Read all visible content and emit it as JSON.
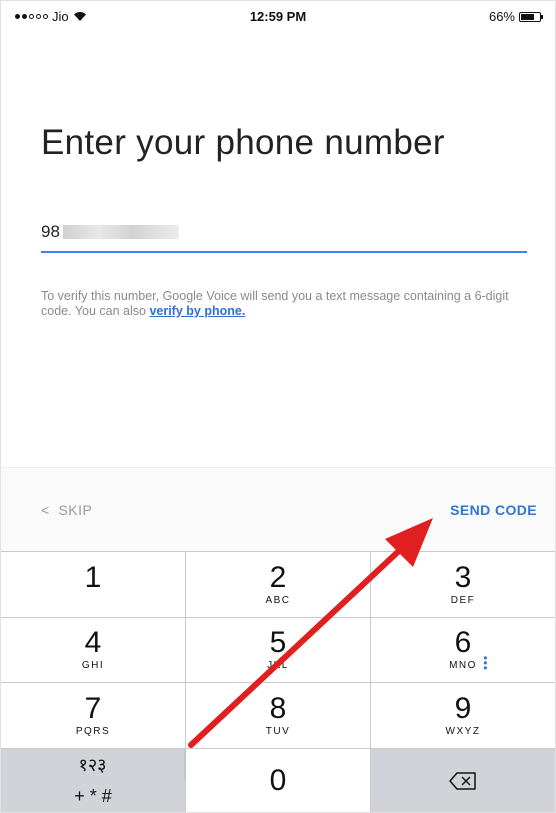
{
  "status_bar": {
    "carrier": "Jio",
    "time": "12:59 PM",
    "battery": "66%"
  },
  "title": "Enter your phone number",
  "phone_field": {
    "value": "98"
  },
  "helper": {
    "text": "To verify this number, Google Voice will send you a text message containing a 6-digit code. You can also ",
    "link": "verify by phone."
  },
  "actions": {
    "skip": "SKIP",
    "send_code": "SEND CODE"
  },
  "keypad": {
    "k1": {
      "digit": "1",
      "letters": ""
    },
    "k2": {
      "digit": "2",
      "letters": "ABC"
    },
    "k3": {
      "digit": "3",
      "letters": "DEF"
    },
    "k4": {
      "digit": "4",
      "letters": "GHI"
    },
    "k5": {
      "digit": "5",
      "letters": "JKL"
    },
    "k6": {
      "digit": "6",
      "letters": "MNO"
    },
    "k7": {
      "digit": "7",
      "letters": "PQRS"
    },
    "k8": {
      "digit": "8",
      "letters": "TUV"
    },
    "k9": {
      "digit": "9",
      "letters": "WXYZ"
    },
    "k0": {
      "digit": "0"
    },
    "numeral_switch": "१२३",
    "symbols": "+ * #"
  },
  "colors": {
    "accent": "#2f76d6",
    "arrow": "#e02020"
  }
}
